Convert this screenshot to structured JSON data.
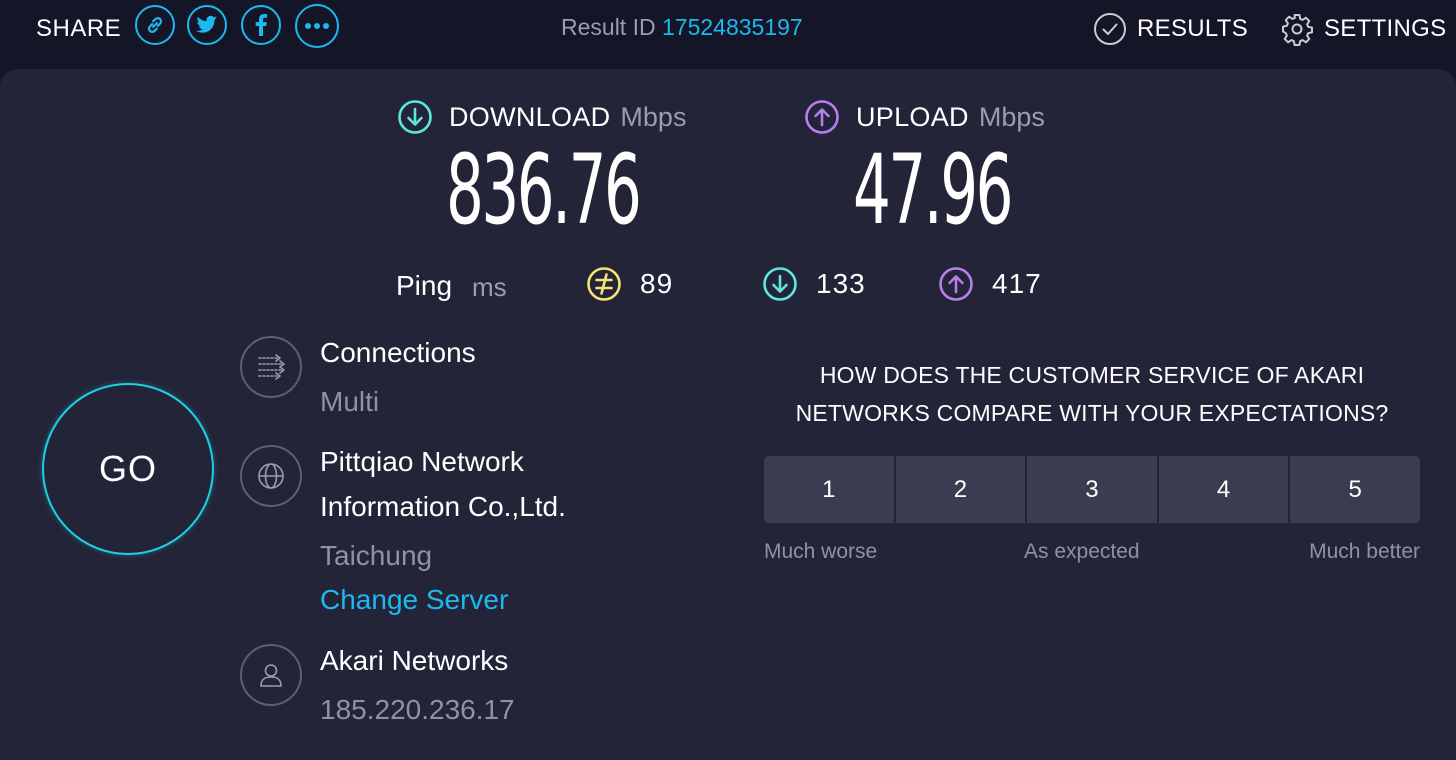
{
  "header": {
    "share_label": "SHARE",
    "share_buttons": [
      {
        "name": "link-icon"
      },
      {
        "name": "twitter-icon"
      },
      {
        "name": "facebook-icon"
      },
      {
        "name": "more-icon"
      }
    ],
    "result_id_label": "Result ID",
    "result_id_value": "17524835197",
    "results_label": "RESULTS",
    "settings_label": "SETTINGS"
  },
  "download": {
    "label": "DOWNLOAD",
    "unit": "Mbps",
    "value": "836.76",
    "icon": "download-arrow-icon",
    "color": "#5ee6dc"
  },
  "upload": {
    "label": "UPLOAD",
    "unit": "Mbps",
    "value": "47.96",
    "icon": "upload-arrow-icon",
    "color": "#b77ef0"
  },
  "ping": {
    "label": "Ping",
    "unit": "ms",
    "idle": {
      "value": "89",
      "icon": "ping-idle-icon",
      "color": "#f5e374"
    },
    "download": {
      "value": "133",
      "icon": "ping-download-icon",
      "color": "#5ee6dc"
    },
    "upload": {
      "value": "417",
      "icon": "ping-upload-icon",
      "color": "#b77ef0"
    }
  },
  "go_button": {
    "label": "GO",
    "color": "#1cd1e2"
  },
  "connections": {
    "title": "Connections",
    "value": "Multi",
    "icon": "connections-icon"
  },
  "server": {
    "name_line1": "Pittqiao Network",
    "name_line2": "Information Co.,Ltd.",
    "location": "Taichung",
    "change_label": "Change Server",
    "icon": "globe-icon"
  },
  "provider": {
    "name": "Akari Networks",
    "ip": "185.220.236.17",
    "icon": "user-icon"
  },
  "survey": {
    "question_line1": "HOW DOES THE CUSTOMER SERVICE OF AKARI",
    "question_line2": "NETWORKS COMPARE WITH YOUR EXPECTATIONS?",
    "options": [
      "1",
      "2",
      "3",
      "4",
      "5"
    ],
    "scale_low": "Much worse",
    "scale_mid": "As expected",
    "scale_high": "Much better"
  },
  "colors": {
    "accent_blue": "#1cb8f0",
    "panel_bg": "#232438",
    "page_bg": "#141526",
    "muted_text": "#8f91a6"
  }
}
